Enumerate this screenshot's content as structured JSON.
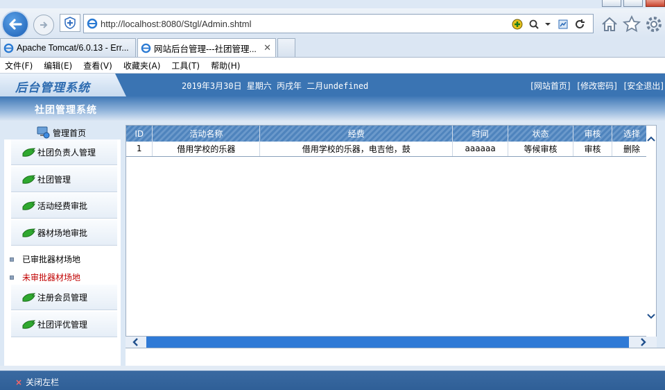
{
  "browser": {
    "address": "http://localhost:8080/Stgl/Admin.shtml",
    "tabs": [
      {
        "label": "Apache Tomcat/6.0.13 - Err..."
      },
      {
        "label": "网站后台管理---社团管理..."
      }
    ],
    "menu": [
      "文件(F)",
      "编辑(E)",
      "查看(V)",
      "收藏夹(A)",
      "工具(T)",
      "帮助(H)"
    ]
  },
  "header": {
    "logo": "后台管理系统",
    "date": "2019年3月30日 星期六 丙戌年 二月undefined",
    "links": [
      "[网站首页]",
      "[修改密码]",
      "[安全退出]"
    ],
    "system_title": "社团管理系统"
  },
  "sidebar": {
    "home": "管理首页",
    "items": [
      {
        "label": "社团负责人管理"
      },
      {
        "label": "社团管理"
      },
      {
        "label": "活动经费审批"
      },
      {
        "label": "器材场地审批"
      }
    ],
    "sub_items": [
      {
        "label": "已审批器材场地"
      },
      {
        "label": "未审批器材场地"
      }
    ],
    "items_after": [
      {
        "label": "注册会员管理"
      },
      {
        "label": "社团评优管理"
      }
    ]
  },
  "table": {
    "columns": [
      "ID",
      "活动名称",
      "经费",
      "时间",
      "状态",
      "审核",
      "选择"
    ],
    "rows": [
      [
        "1",
        "借用学校的乐器",
        "借用学校的乐器，电吉他，鼓",
        "aaaaaa",
        "等候审核",
        "审核",
        "删除"
      ]
    ]
  },
  "footer": {
    "close_sidebar": "关闭左栏"
  },
  "colors": {
    "header_blue": "#3a74b3",
    "table_header": "#4f84bd",
    "scroll_blue": "#2f7ad6",
    "unapproved_red": "#c00000"
  }
}
